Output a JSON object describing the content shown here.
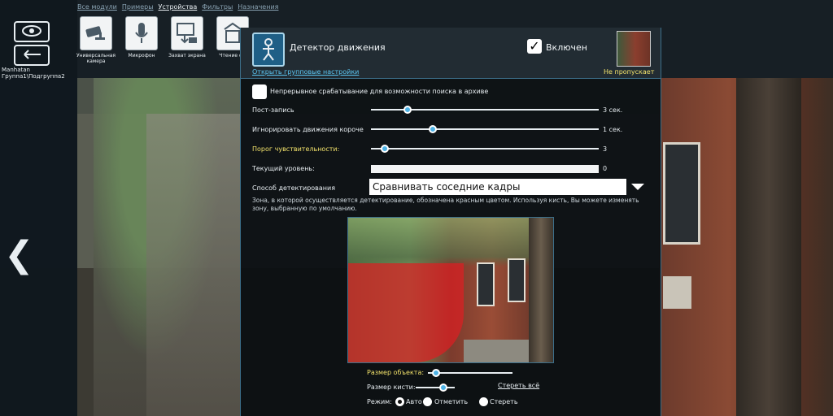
{
  "menu": [
    {
      "label": "Все модули",
      "active": false
    },
    {
      "label": "Примеры",
      "active": false
    },
    {
      "label": "Устройства",
      "active": true
    },
    {
      "label": "Фильтры",
      "active": false
    },
    {
      "label": "Назначения",
      "active": false
    }
  ],
  "left": {
    "camera_name_line1": "Manhatan",
    "camera_name_line2": "Группа1\\Подгруппа2",
    "view_icon": "eye-icon",
    "back_icon": "back-arrow-icon",
    "nav_prev_icon": "chevron-left-icon"
  },
  "devices": [
    {
      "label": "Универсальная камера",
      "icon": "camera-icon"
    },
    {
      "label": "Микрофон",
      "icon": "microphone-icon"
    },
    {
      "label": "Захват экрана",
      "icon": "screen-capture-icon"
    },
    {
      "label": "Чтение фа",
      "icon": "file-read-icon"
    }
  ],
  "dialog": {
    "title": "Детектор движения",
    "group_settings_link": "Открыть групповые настройки",
    "enabled_label": "Включен",
    "enabled": true,
    "no_skip_label": "Не пропускает",
    "continuous_label": "Непрерывное срабатывание для возможности поиска в архиве",
    "continuous_checked": false,
    "sliders": [
      {
        "label": "Пост-запись",
        "value_text": "3 сек.",
        "fraction": 0.16,
        "highlight": false
      },
      {
        "label": "Игнорировать движения короче",
        "value_text": "1 сек.",
        "fraction": 0.27,
        "highlight": false
      },
      {
        "label": "Порог чувствительности:",
        "value_text": "3",
        "fraction": 0.06,
        "highlight": true
      }
    ],
    "level_label": "Текущий уровень:",
    "level_value": "0",
    "method_label": "Способ детектирования",
    "method_value": "Сравнивать соседние кадры",
    "zone_hint": "Зона, в которой осуществляется детектирование, обозначена красным цветом. Используя кисть, Вы можете изменять зону, выбранную по умолчанию.",
    "object_size_label": "Размер объекта:",
    "object_size_fraction": 0.1,
    "brush_size_label": "Размер кисти:",
    "brush_size_fraction": 0.7,
    "clear_all_label": "Стереть всё",
    "mode_label": "Режим:",
    "modes": [
      {
        "label": "Авто",
        "selected": true
      },
      {
        "label": "Отметить",
        "selected": false
      },
      {
        "label": "Стереть",
        "selected": false
      }
    ]
  },
  "colors": {
    "accent": "#4fb3e6",
    "link": "#5cc6f2",
    "highlight": "#f2e26b",
    "zone_red": "#dc1e23"
  }
}
